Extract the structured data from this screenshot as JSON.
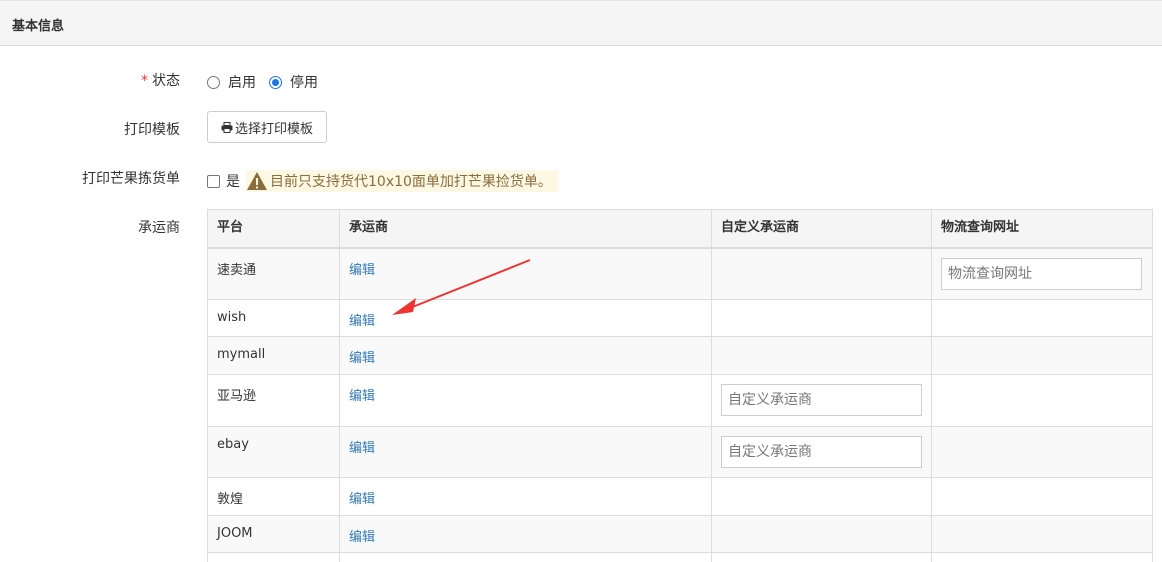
{
  "panel": {
    "title": "基本信息"
  },
  "form": {
    "status": {
      "label": "状态",
      "required_mark": "*",
      "options": [
        {
          "label": "启用",
          "checked": false
        },
        {
          "label": "停用",
          "checked": true
        }
      ]
    },
    "print_template": {
      "label": "打印模板",
      "button_label": "选择打印模板"
    },
    "mango_picking": {
      "label": "打印芒果拣货单",
      "checkbox_label": "是",
      "checked": false,
      "warning": "目前只支持货代10x10面单加打芒果捡货单。"
    },
    "carrier": {
      "label": "承运商"
    }
  },
  "table": {
    "columns": [
      "平台",
      "承运商",
      "自定义承运商",
      "物流查询网址"
    ],
    "rows": [
      {
        "platform": "速卖通",
        "carrier": "编辑",
        "custom_carrier": null,
        "tracking_url": {
          "placeholder": "物流查询网址"
        }
      },
      {
        "platform": "wish",
        "carrier": "编辑",
        "custom_carrier": null,
        "tracking_url": null
      },
      {
        "platform": "mymall",
        "carrier": "编辑",
        "custom_carrier": null,
        "tracking_url": null
      },
      {
        "platform": "亚马逊",
        "carrier": "编辑",
        "custom_carrier": {
          "placeholder": "自定义承运商"
        },
        "tracking_url": null
      },
      {
        "platform": "ebay",
        "carrier": "编辑",
        "custom_carrier": {
          "placeholder": "自定义承运商"
        },
        "tracking_url": null
      },
      {
        "platform": "敦煌",
        "carrier": "编辑",
        "custom_carrier": null,
        "tracking_url": null
      },
      {
        "platform": "JOOM",
        "carrier": "编辑",
        "custom_carrier": null,
        "tracking_url": null
      }
    ]
  },
  "colors": {
    "link": "#337ab7",
    "required": "#e4393c",
    "warning_bg": "#fcf8e3",
    "warning_text": "#8a6d3b",
    "annotation_arrow": "#ee3333"
  }
}
